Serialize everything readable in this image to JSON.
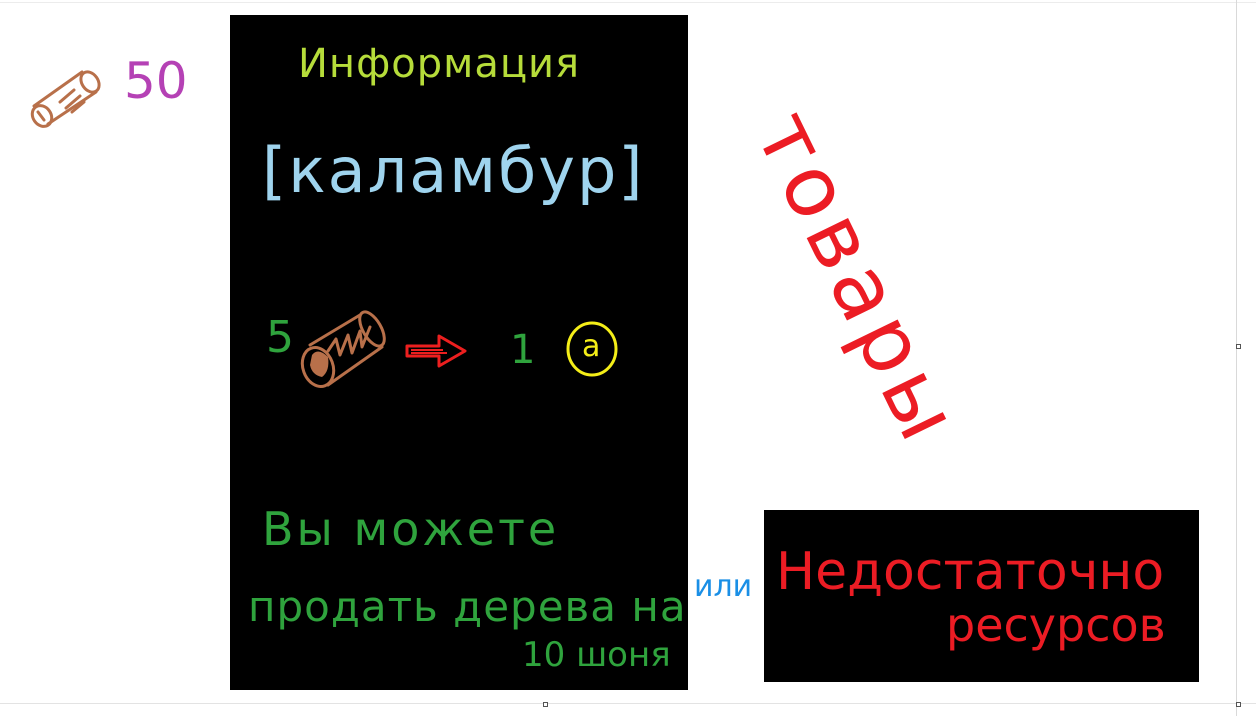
{
  "resources": {
    "wood_count": "50",
    "wood_icon": "log-icon"
  },
  "info_panel": {
    "title": "Информация",
    "item_name": "[каламбур]",
    "trade": {
      "input_qty": "5",
      "output_qty": "1",
      "coin_symbol": "a"
    },
    "message_line1": "Вы можете",
    "message_line2": "продать дерева на",
    "message_line3": "10 шоня",
    "or_text": "или"
  },
  "goods_label": "товары",
  "error_panel": {
    "line1": "Недостаточно",
    "line2": "ресурсов"
  },
  "colors": {
    "wood": "#b8704a",
    "count": "#b541b5",
    "title": "#b6dc3a",
    "item_name": "#9fd4ee",
    "trade_text": "#2fa33d",
    "arrow": "#ec1f1f",
    "coin": "#f4ee18",
    "or_text": "#1a8fe6",
    "goods": "#ec1c24",
    "error_text": "#ec1c24"
  }
}
